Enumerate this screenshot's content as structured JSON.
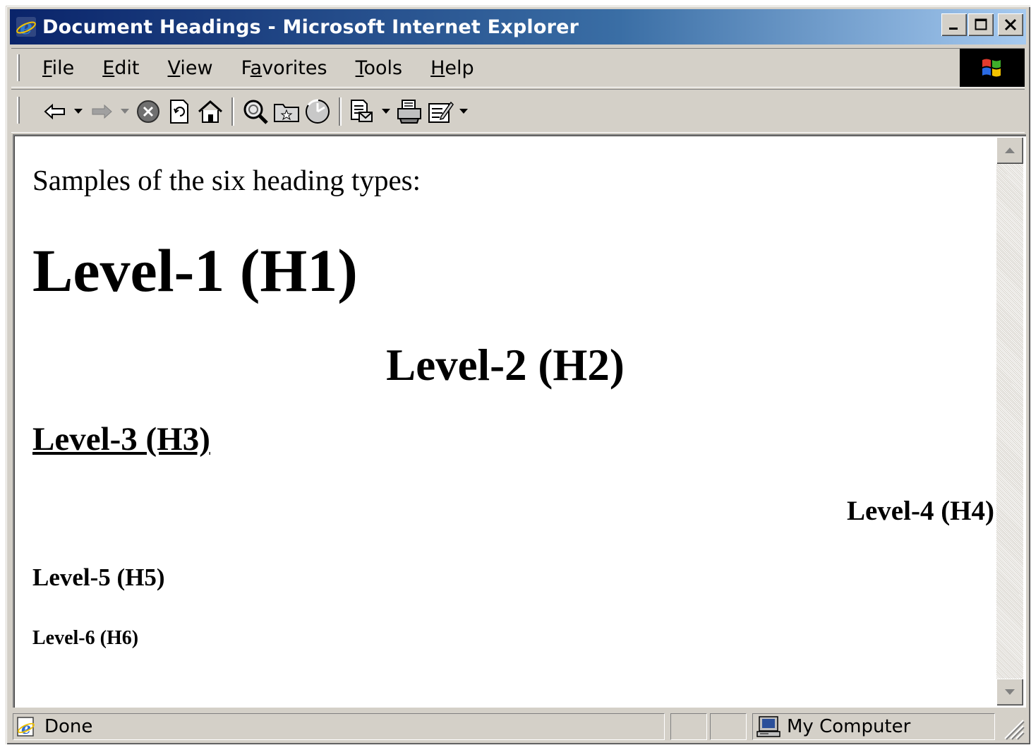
{
  "window": {
    "title": "Document Headings - Microsoft Internet Explorer",
    "controls": {
      "minimize": "minimize",
      "maximize": "maximize",
      "close": "close"
    }
  },
  "menubar": {
    "items": [
      {
        "label": "File",
        "accel": "F",
        "rest": "ile"
      },
      {
        "label": "Edit",
        "accel": "E",
        "rest": "dit"
      },
      {
        "label": "View",
        "accel": "V",
        "rest": "iew"
      },
      {
        "label": "Favorites",
        "pre": "F",
        "accel": "a",
        "rest": "vorites"
      },
      {
        "label": "Tools",
        "accel": "T",
        "rest": "ools"
      },
      {
        "label": "Help",
        "accel": "H",
        "rest": "elp"
      }
    ]
  },
  "toolbar": {
    "icons": [
      "back-icon",
      "dropdown-arrow-icon",
      "forward-icon",
      "dropdown-arrow-icon",
      "stop-icon",
      "refresh-icon",
      "home-icon",
      "search-icon",
      "favorites-icon",
      "history-icon",
      "mail-icon",
      "print-icon",
      "edit-icon",
      "dropdown-arrow-icon"
    ]
  },
  "page": {
    "intro": "Samples of the six heading types:",
    "h1": "Level-1 (H1)",
    "h2": "Level-2 (H2)",
    "h3": "Level-3 (H3)",
    "h4": "Level-4 (H4)",
    "h5": "Level-5 (H5)",
    "h6": "Level-6 (H6)"
  },
  "statusbar": {
    "status": "Done",
    "zone": "My Computer"
  },
  "colors": {
    "titlebar_start": "#0a246a",
    "titlebar_end": "#a6caf0",
    "chrome": "#d4d0c8"
  }
}
